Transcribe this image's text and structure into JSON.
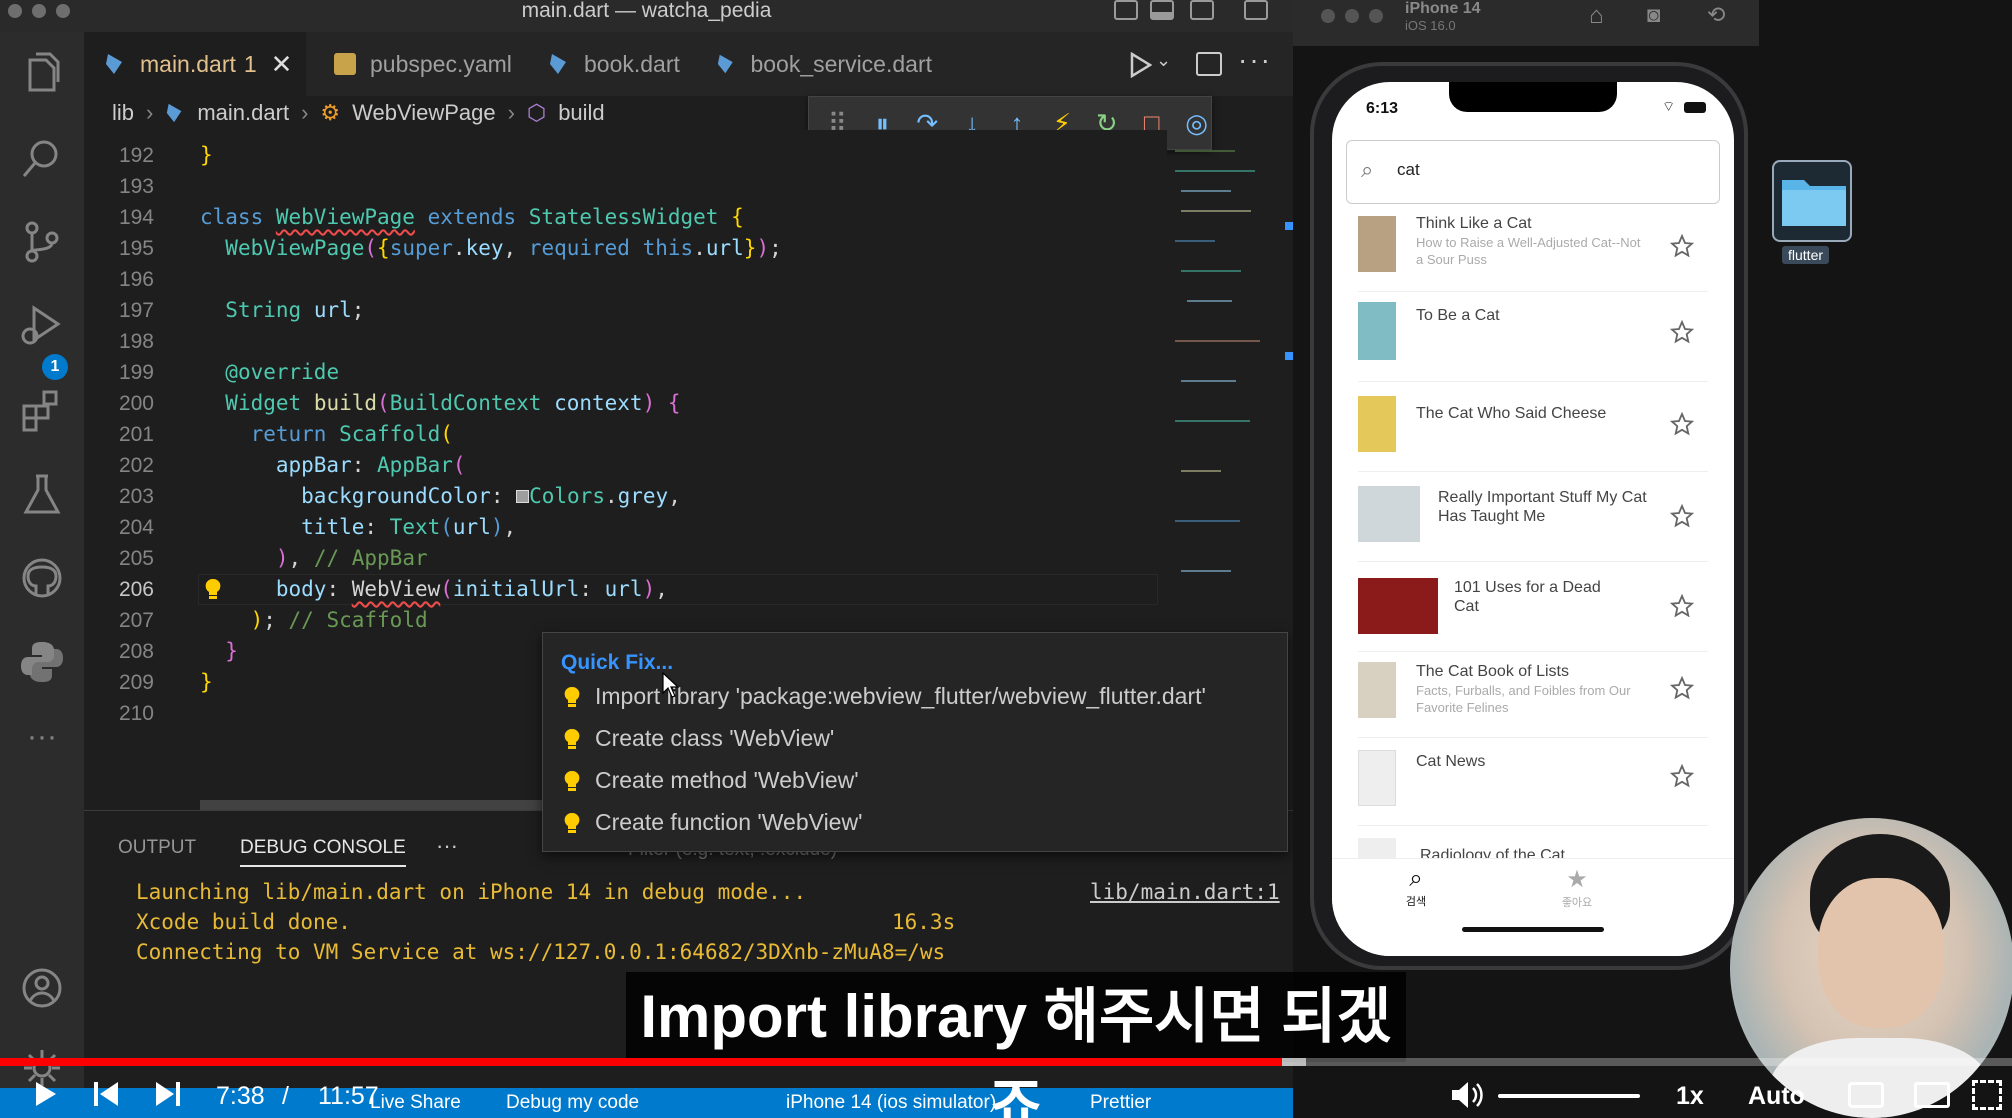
{
  "window": {
    "title": "main.dart — watcha_pedia"
  },
  "tabs": [
    {
      "label": "main.dart",
      "badge": "1",
      "active": true
    },
    {
      "label": "pubspec.yaml"
    },
    {
      "label": "book.dart"
    },
    {
      "label": "book_service.dart"
    }
  ],
  "breadcrumb": {
    "folder": "lib",
    "file": "main.dart",
    "class_name": "WebViewPage",
    "method": "build"
  },
  "activity_badge": "1",
  "editor": {
    "line_numbers": [
      "192",
      "193",
      "194",
      "195",
      "196",
      "197",
      "198",
      "199",
      "200",
      "201",
      "202",
      "203",
      "204",
      "205",
      "206",
      "207",
      "208",
      "209",
      "210"
    ],
    "current_line": "206"
  },
  "quickfix": {
    "title": "Quick Fix...",
    "items": [
      "Import library 'package:webview_flutter/webview_flutter.dart'",
      "Create class 'WebView'",
      "Create method 'WebView'",
      "Create function 'WebView'"
    ]
  },
  "panel": {
    "tabs": [
      "OUTPUT",
      "DEBUG CONSOLE",
      "···"
    ],
    "filter_placeholder": "Filter (e.g. text, !exclude)",
    "lines": [
      "Launching lib/main.dart on iPhone 14 in debug mode...",
      "Xcode build done.",
      "Connecting to VM Service at ws://127.0.0.1:64682/3DXnb-zMuA8=/ws"
    ],
    "duration": "16.3s",
    "source_link": "lib/main.dart:1"
  },
  "statusbar": {
    "items": [
      "Live Share",
      "Debug my code",
      "iPhone 14 (ios simulator)",
      "Prettier"
    ]
  },
  "simulator": {
    "device": "iPhone 14",
    "os": "iOS 16.0",
    "time": "6:13",
    "search_value": "cat",
    "books": [
      {
        "title": "Think Like a Cat",
        "subtitle": "How to Raise a Well-Adjusted Cat--Not a Sour Puss"
      },
      {
        "title": "To Be a Cat",
        "subtitle": ""
      },
      {
        "title": "The Cat Who Said Cheese",
        "subtitle": ""
      },
      {
        "title": "Really Important Stuff My Cat Has Taught Me",
        "subtitle": ""
      },
      {
        "title": "101 Uses for a Dead Cat",
        "subtitle": ""
      },
      {
        "title": "The Cat Book of Lists",
        "subtitle": "Facts, Furballs, and Foibles from Our Favorite Felines"
      },
      {
        "title": "Cat News",
        "subtitle": ""
      },
      {
        "title": "Radiology of the Cat",
        "subtitle": ""
      }
    ],
    "nav": [
      {
        "label": "검색"
      },
      {
        "label": "좋아요"
      }
    ],
    "desktop_folder": "flutter"
  },
  "video": {
    "subtitle": "Import library 해주시면 되겠죠",
    "current_time": "7:38",
    "separator": "/",
    "duration": "11:57",
    "progress": 0.637,
    "speed": "1x",
    "quality": "Auto"
  },
  "colors": {
    "accent": "#007acc",
    "progress": "#ff0000",
    "quickfix_title": "#3794ff",
    "bulb": "#ffcc00"
  }
}
